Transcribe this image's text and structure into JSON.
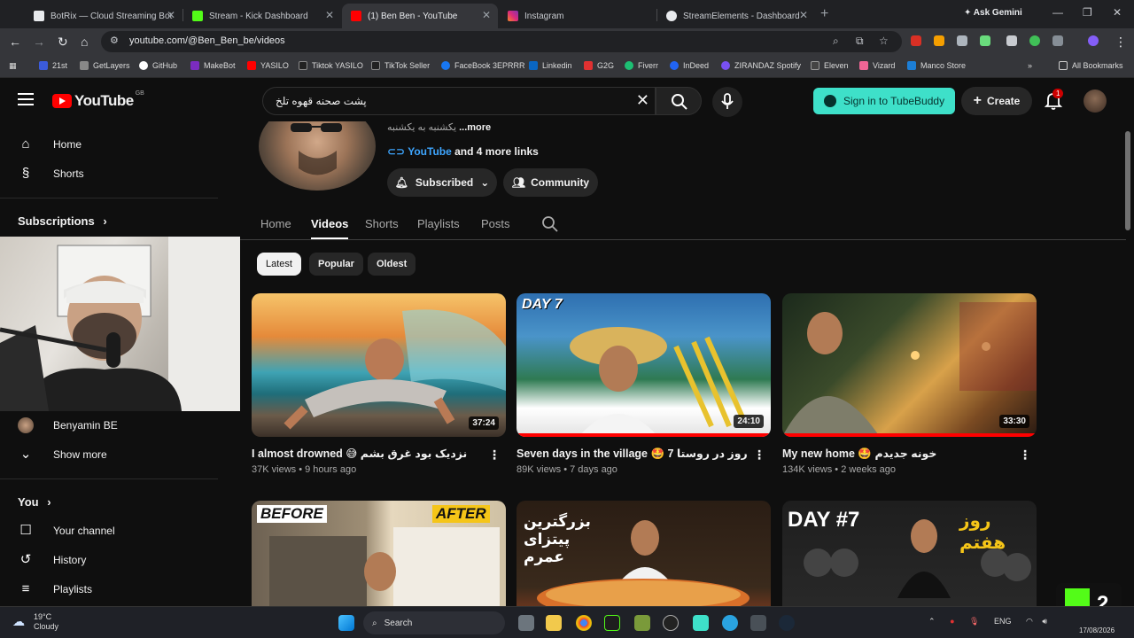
{
  "browser": {
    "tabs": [
      {
        "title": "BotRix — Cloud Streaming Bot",
        "color": "#1a1a1a"
      },
      {
        "title": "Stream - Kick Dashboard",
        "color": "#53fc18"
      },
      {
        "title": "(1) Ben Ben - YouTube",
        "color": "#ff0000"
      },
      {
        "title": "Instagram",
        "color": "#e1306c"
      },
      {
        "title": "StreamElements - Dashboard",
        "color": "#ffffff"
      }
    ],
    "ask_gemini": "Ask Gemini",
    "url": "youtube.com/@Ben_Ben_be/videos",
    "bookmarks": [
      {
        "label": "21st",
        "color": "#3b5bdb"
      },
      {
        "label": "GetLayers",
        "color": "#888888"
      },
      {
        "label": "GitHub",
        "color": "#ffffff"
      },
      {
        "label": "MakeBot",
        "color": "#7b2cbf"
      },
      {
        "label": "YASILO",
        "color": "#ff0000"
      },
      {
        "label": "Tiktok YASILO",
        "color": "#222222"
      },
      {
        "label": "TikTok Seller",
        "color": "#222222"
      },
      {
        "label": "FaceBook 3EPRRR",
        "color": "#1877f2"
      },
      {
        "label": "Linkedin",
        "color": "#0a66c2"
      },
      {
        "label": "G2G",
        "color": "#e03131"
      },
      {
        "label": "Fiverr",
        "color": "#1dbf73"
      },
      {
        "label": "InDeed",
        "color": "#2164f3"
      },
      {
        "label": "ZIRANDAZ Spotify",
        "color": "#7950f2"
      },
      {
        "label": "Eleven",
        "color": "#444444"
      },
      {
        "label": "Vizard",
        "color": "#f06595"
      },
      {
        "label": "Manco Store",
        "color": "#1c7ed6"
      }
    ],
    "all_bookmarks": "All Bookmarks"
  },
  "yt": {
    "logo": "YouTube",
    "region": "GB",
    "search_value": "پشت صحنه قهوه تلخ",
    "tubebuddy": "Sign in to TubeBuddy",
    "create": "Create",
    "notif_count": "1"
  },
  "sidebar": {
    "home": "Home",
    "shorts": "Shorts",
    "subscriptions": "Subscriptions",
    "sub_channel": "Benyamin BE",
    "show_more": "Show more",
    "you": "You",
    "your_channel": "Your channel",
    "history": "History",
    "playlists": "Playlists"
  },
  "channel": {
    "desc": "یکشنبه به یکشنبه",
    "desc_more": "...more",
    "links_youtube": "YouTube",
    "links_more": "and 4 more links",
    "subscribed": "Subscribed",
    "community": "Community",
    "tabs": [
      "Home",
      "Videos",
      "Shorts",
      "Playlists",
      "Posts"
    ],
    "chips": [
      "Latest",
      "Popular",
      "Oldest"
    ]
  },
  "videos": [
    {
      "title": "I almost drowned 😅 نزدیک بود غرق بشم",
      "meta": "37K views • 9 hours ago",
      "duration": "37:24",
      "watched": 0
    },
    {
      "title": "Seven days in the village 🤩 7 روز در روستا",
      "meta": "89K views • 7 days ago",
      "duration": "24:10",
      "watched": 1,
      "overlay": "DAY 7"
    },
    {
      "title": "My new home 🤩 خونه جدیدم",
      "meta": "134K views • 2 weeks ago",
      "duration": "33:30",
      "watched": 1
    },
    {
      "title": "",
      "meta": "",
      "duration": "",
      "overlay_left": "BEFORE",
      "overlay_right": "AFTER"
    },
    {
      "title": "",
      "meta": "",
      "duration": "",
      "overlay": "بزرگترین پیتزای عمرم"
    },
    {
      "title": "",
      "meta": "",
      "duration": "",
      "overlay": "DAY #7",
      "overlay_right": "روز هفتم"
    }
  ],
  "taskbar": {
    "temp": "19°C",
    "cond": "Cloudy",
    "search": "Search",
    "lang": "ENG",
    "date": "17/08/2026",
    "kick_number": "2"
  }
}
